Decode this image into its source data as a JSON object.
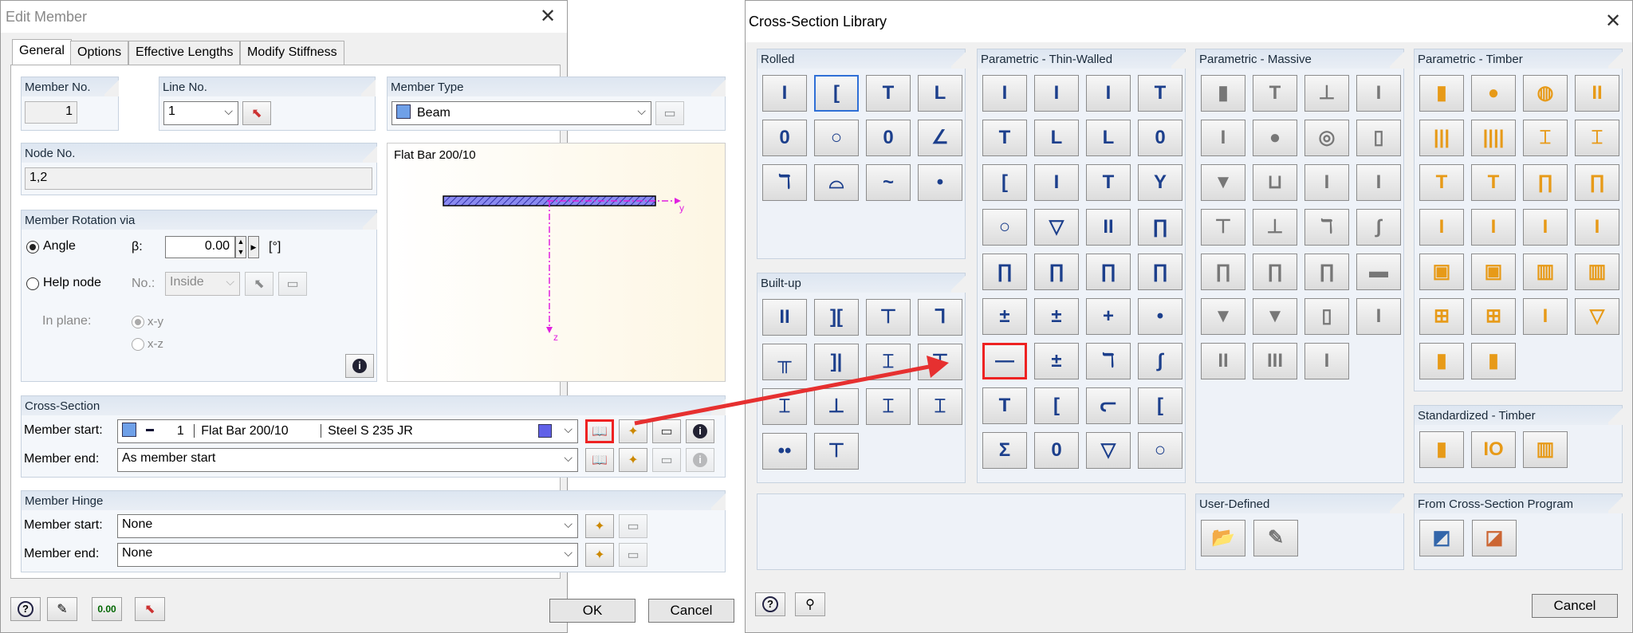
{
  "edit": {
    "title": "Edit Member",
    "tabs": [
      "General",
      "Options",
      "Effective Lengths",
      "Modify Stiffness"
    ],
    "member_no_label": "Member No.",
    "member_no": "1",
    "line_no_label": "Line No.",
    "line_no": "1",
    "member_type_label": "Member Type",
    "member_type": "Beam",
    "node_no_label": "Node No.",
    "node_no": "1,2",
    "preview_title": "Flat Bar 200/10",
    "axis_y": "y",
    "axis_z": "z",
    "rotation_label": "Member Rotation via",
    "angle_label": "Angle",
    "beta_label": "β:",
    "beta_value": "0.00",
    "beta_unit": "[°]",
    "help_node_label": "Help node",
    "no_label": "No.:",
    "no_value": "Inside",
    "in_plane_label": "In plane:",
    "xy": "x-y",
    "xz": "x-z",
    "cross_section_label": "Cross-Section",
    "member_start_label": "Member start:",
    "member_end_label": "Member end:",
    "cs_start_no": "1",
    "cs_start_name": "Flat Bar 200/10",
    "cs_start_mat": "Steel S 235 JR",
    "cs_end": "As member start",
    "hinge_label": "Member Hinge",
    "hinge_start": "None",
    "hinge_end": "None",
    "ok": "OK",
    "cancel": "Cancel"
  },
  "lib": {
    "title": "Cross-Section Library",
    "rolled": "Rolled",
    "builtup": "Built-up",
    "thin": "Parametric - Thin-Walled",
    "massive": "Parametric - Massive",
    "timber": "Parametric - Timber",
    "std_timber": "Standardized - Timber",
    "user": "User-Defined",
    "from_prog": "From Cross-Section Program",
    "cancel": "Cancel",
    "rolled_icons": [
      "I",
      "[",
      "T",
      "L",
      "0",
      "○",
      "0",
      "∠",
      "ℸ",
      "⌓",
      "~",
      "•"
    ],
    "builtup_icons": [
      "II",
      "][",
      "⊤",
      "ᒣ",
      "╥",
      "]|",
      "⌶",
      "⊤",
      "⌶",
      "⊥",
      "⌶",
      "⌶",
      "••",
      "⊤"
    ],
    "thin_icons": [
      "I",
      "I",
      "I",
      "T",
      "T",
      "L",
      "L",
      "0",
      "[",
      "I",
      "T",
      "Y",
      "○",
      "▽",
      "II",
      "∏",
      "∏",
      "∏",
      "∏",
      "∏",
      "±",
      "±",
      "+",
      "•",
      "—",
      "±",
      "ℸ",
      "∫",
      "T",
      "[",
      "ᓕ",
      "[",
      "Σ",
      "0",
      "▽",
      "○"
    ],
    "massive_icons": [
      "▮",
      "T",
      "⊥",
      "I",
      "I",
      "●",
      "◎",
      "▯",
      "▼",
      "⊔",
      "I",
      "I",
      "⊤",
      "⊥",
      "ℸ",
      "∫",
      "∏",
      "∏",
      "∏",
      "▬",
      "▼",
      "▼",
      "▯",
      "I",
      "II",
      "III",
      "I"
    ],
    "timber_icons": [
      "▮",
      "●",
      "◍",
      "II",
      "|||",
      "||||",
      "⌶",
      "⌶",
      "T",
      "T",
      "∏",
      "∏",
      "I",
      "I",
      "I",
      "I",
      "▣",
      "▣",
      "▥",
      "▥",
      "⊞",
      "⊞",
      "I",
      "▽",
      "▮",
      "▮"
    ],
    "std_timber_icons": [
      "▮",
      "IO",
      "▥"
    ]
  }
}
